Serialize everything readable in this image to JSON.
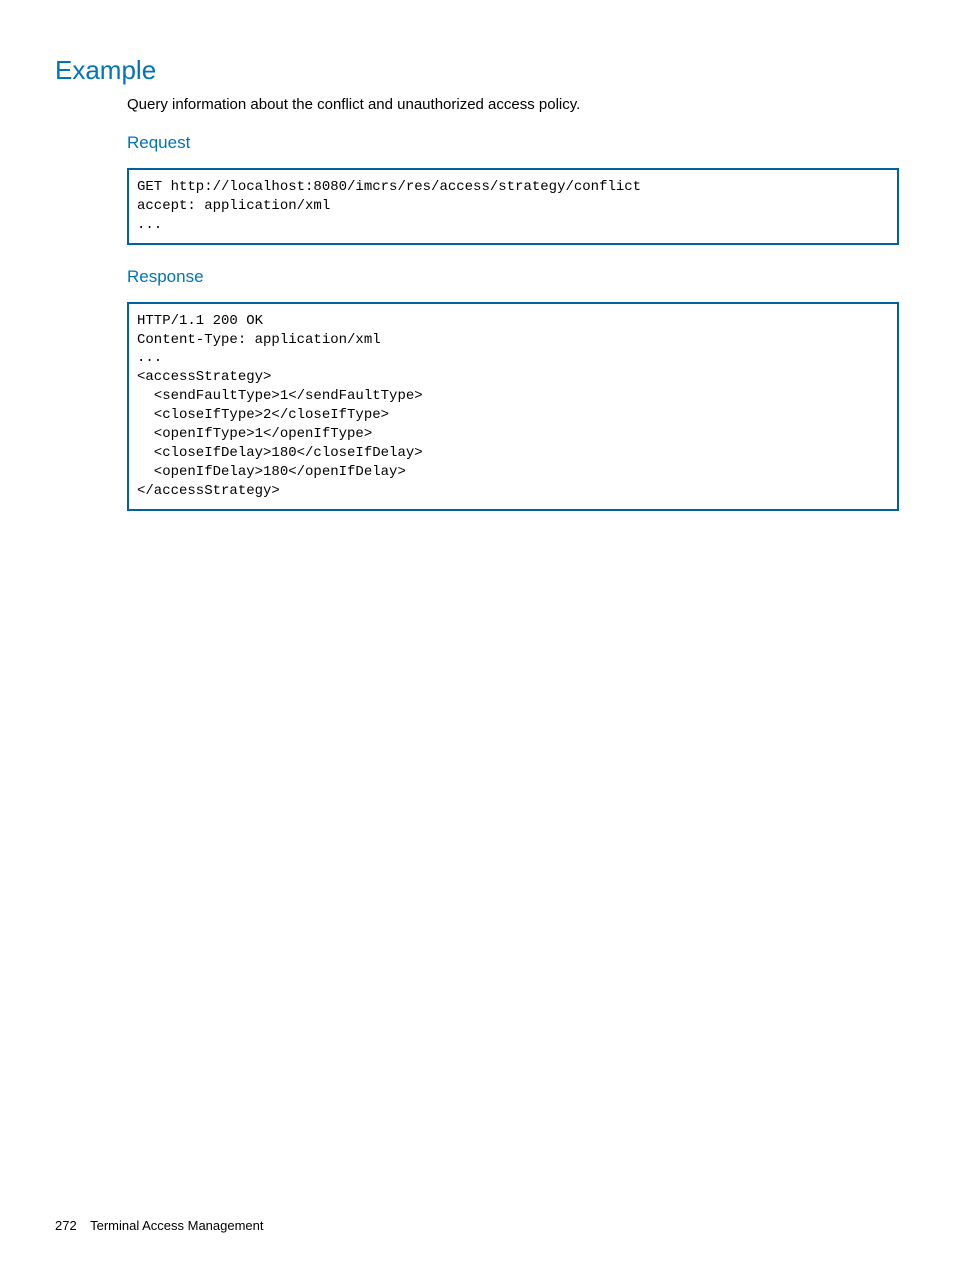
{
  "heading": "Example",
  "intro": "Query information about the conflict and unauthorized access policy.",
  "request": {
    "title": "Request",
    "code": "GET http://localhost:8080/imcrs/res/access/strategy/conflict\naccept: application/xml\n..."
  },
  "response": {
    "title": "Response",
    "code": "HTTP/1.1 200 OK\nContent-Type: application/xml\n...\n<accessStrategy>\n  <sendFaultType>1</sendFaultType>\n  <closeIfType>2</closeIfType>\n  <openIfType>1</openIfType>\n  <closeIfDelay>180</closeIfDelay>\n  <openIfDelay>180</openIfDelay>\n</accessStrategy>"
  },
  "footer": {
    "page": "272",
    "section": "Terminal Access Management"
  }
}
